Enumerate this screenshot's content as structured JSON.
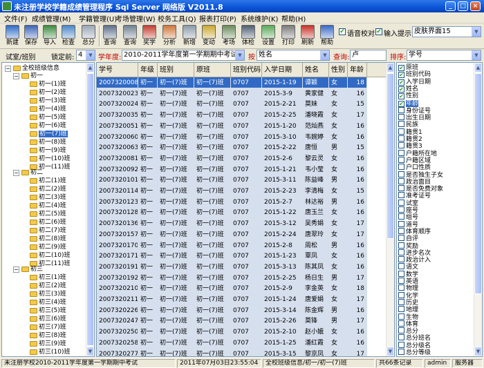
{
  "window": {
    "title": "未注册学校学籍成绩管理程序 Sql Server 网络版 V2011.8",
    "min_label": "_",
    "max_label": "□",
    "close_label": "×"
  },
  "menu": [
    "文件(F)",
    "成绩管理(M)",
    "学籍管理(U)",
    "考场管理(W)",
    "校务工具(Q)",
    "报表打印(P)",
    "系统维护(K)",
    "帮助(H)"
  ],
  "toolbar": {
    "buttons": [
      {
        "label": "新建",
        "icon": "new-icon",
        "color": "#2E6BC7"
      },
      {
        "label": "保存",
        "icon": "save-icon",
        "color": "#3A63B8"
      },
      {
        "label": "导入",
        "icon": "import-icon",
        "color": "#3D8A3D"
      },
      {
        "label": "检查",
        "icon": "check-icon",
        "color": "#4A86C8"
      },
      {
        "label": "总分",
        "icon": "total-icon",
        "color": "#9AA6B6"
      },
      {
        "label": "查询",
        "icon": "query-icon",
        "color": "#5C6E88"
      },
      {
        "label": "查询",
        "icon": "query2-icon",
        "color": "#708090"
      },
      {
        "label": "奖学",
        "icon": "award-icon",
        "color": "#C43C2E"
      },
      {
        "label": "分析",
        "icon": "analyze-icon",
        "color": "#D0763A"
      },
      {
        "label": "新增",
        "icon": "add-icon",
        "color": "#8A9AAA"
      },
      {
        "label": "变动",
        "icon": "change-icon",
        "color": "#C8A830"
      },
      {
        "label": "考场",
        "icon": "exam-room-icon",
        "color": "#6A8A5A"
      },
      {
        "label": "体检",
        "icon": "physical-icon",
        "color": "#4E5E70"
      },
      {
        "label": "设置",
        "icon": "settings-icon",
        "color": "#5AAA5A"
      },
      {
        "label": "打印",
        "icon": "print-icon",
        "color": "#7A7A7A"
      },
      {
        "label": "刷新",
        "icon": "refresh-icon",
        "color": "#C8322A"
      },
      {
        "label": "帮助",
        "icon": "help-icon",
        "color": "#3A6AC8"
      }
    ],
    "voice_check_label": "语音校对",
    "input_hint_label": "输入提示",
    "skin_value": "皮肤界面15"
  },
  "filter": {
    "class_label": "试室/班别",
    "lock_label": "锁定前:",
    "lock_value": "4",
    "term_label": "学年度:",
    "term_value": "2010-2011学年度第一学期期中考试",
    "by_label": "按",
    "by_value": "姓名",
    "query_label": "查询:",
    "query_value": "卢",
    "sort_label": "排序:",
    "sort_value": "学号"
  },
  "tree": {
    "root": "全校班级信息",
    "grade1": "初一",
    "grade1_classes": [
      "初一(1)班",
      "初一(2)班",
      "初一(3)班",
      "初一(4)班",
      "初一(5)班",
      "初一(6)班",
      "初一(7)班",
      "初一(8)班",
      "初一(9)班",
      "初一(10)班",
      "初一(11)班"
    ],
    "grade2": "初二",
    "grade2_classes": [
      "初二(1)班",
      "初二(2)班",
      "初二(3)班",
      "初二(4)班",
      "初二(5)班",
      "初二(6)班",
      "初二(7)班",
      "初二(8)班",
      "初二(9)班",
      "初二(10)班",
      "初二(11)班"
    ],
    "grade3": "初三",
    "grade3_classes": [
      "初三(1)班",
      "初三(2)班",
      "初三(3)班",
      "初三(4)班",
      "初三(5)班",
      "初三(6)班",
      "初三(7)班",
      "初三(8)班",
      "初三(9)班",
      "初三(10)班"
    ]
  },
  "grid": {
    "columns": [
      "学号",
      "年级",
      "班别",
      "原班",
      "班别代码",
      "入学日期",
      "姓名",
      "性别",
      "年龄"
    ],
    "rows": [
      [
        "2007320008",
        "初一",
        "初一(7)班",
        "初一(7)班",
        "0707",
        "2015-1-19",
        "谭颖",
        "女",
        "18"
      ],
      [
        "2007320023",
        "初一",
        "初一(7)班",
        "初一(7)班",
        "0707",
        "2015-3-9",
        "黄家健",
        "女",
        "16"
      ],
      [
        "2007320024",
        "初一",
        "初一(7)班",
        "初一(7)班",
        "0707",
        "2015-2-21",
        "莫妹",
        "女",
        "15"
      ],
      [
        "2007320035",
        "初一",
        "初一(7)班",
        "初一(7)班",
        "0707",
        "2015-2-25",
        "潘晓霞",
        "女",
        "17"
      ],
      [
        "2007320051",
        "初一",
        "初一(7)班",
        "初一(7)班",
        "0707",
        "2015-1-20",
        "范灿燕",
        "女",
        "16"
      ],
      [
        "2007320060",
        "初一",
        "初一(7)班",
        "初一(7)班",
        "0707",
        "2015-3-10",
        "韦婉婷",
        "女",
        "16"
      ],
      [
        "2007320063",
        "初一",
        "初一(7)班",
        "初一(7)班",
        "0707",
        "2015-2-22",
        "唐恒",
        "男",
        "15"
      ],
      [
        "2007320081",
        "初一",
        "初一(7)班",
        "初一(7)班",
        "0707",
        "2015-2-6",
        "黎云灵",
        "女",
        "16"
      ],
      [
        "2007320092",
        "初一",
        "初一(7)班",
        "初一(7)班",
        "0707",
        "2015-1-21",
        "韦小莹",
        "女",
        "16"
      ],
      [
        "2007320101",
        "初一",
        "初一(7)班",
        "初一(7)班",
        "0707",
        "2015-3-11",
        "陈益峰",
        "男",
        "16"
      ],
      [
        "2007320114",
        "初一",
        "初一(7)班",
        "初一(7)班",
        "0707",
        "2015-2-23",
        "李清梅",
        "女",
        "15"
      ],
      [
        "2007320123",
        "初一",
        "初一(7)班",
        "初一(7)班",
        "0707",
        "2015-2-7",
        "林达裕",
        "男",
        "16"
      ],
      [
        "2007320128",
        "初一",
        "初一(7)班",
        "初一(7)班",
        "0707",
        "2015-1-22",
        "唐玉兰",
        "女",
        "16"
      ],
      [
        "2007320136",
        "初一",
        "初一(7)班",
        "初一(7)班",
        "0707",
        "2015-3-12",
        "吴秀娟",
        "女",
        "17"
      ],
      [
        "2007320157",
        "初一",
        "初一(7)班",
        "初一(7)班",
        "0707",
        "2015-2-24",
        "唐翠玲",
        "女",
        "17"
      ],
      [
        "2007320170",
        "初一",
        "初一(7)班",
        "初一(7)班",
        "0707",
        "2015-2-8",
        "周松",
        "男",
        "16"
      ],
      [
        "2007320171",
        "初一",
        "初一(7)班",
        "初一(7)班",
        "0707",
        "2015-1-23",
        "覃凤",
        "女",
        "16"
      ],
      [
        "2007320191",
        "初一",
        "初一(7)班",
        "初一(7)班",
        "0707",
        "2015-3-13",
        "陈其凤",
        "女",
        "16"
      ],
      [
        "2007320192",
        "初一",
        "初一(7)班",
        "初一(7)班",
        "0707",
        "2015-2-25",
        "杨日生",
        "男",
        "17"
      ],
      [
        "2007320210",
        "初一",
        "初一(7)班",
        "初一(7)班",
        "0707",
        "2015-2-9",
        "李金英",
        "女",
        "18"
      ],
      [
        "2007320211",
        "初一",
        "初一(7)班",
        "初一(7)班",
        "0707",
        "2015-1-24",
        "唐爱娟",
        "女",
        "17"
      ],
      [
        "2007320226",
        "初一",
        "初一(7)班",
        "初一(7)班",
        "0707",
        "2015-3-14",
        "陈金辉",
        "男",
        "16"
      ],
      [
        "2007320247",
        "初一",
        "初一(7)班",
        "初一(7)班",
        "0707",
        "2015-2-26",
        "莫锋",
        "男",
        "17"
      ],
      [
        "2007320250",
        "初一",
        "初一(7)班",
        "初一(7)班",
        "0707",
        "2015-2-10",
        "赵小娥",
        "女",
        "16"
      ],
      [
        "2007320258",
        "初一",
        "初一(7)班",
        "初一(7)班",
        "0707",
        "2015-1-25",
        "潘红霞",
        "女",
        "16"
      ],
      [
        "2007320277",
        "初一",
        "初一(7)班",
        "初一(7)班",
        "0707",
        "2015-3-15",
        "黎京凤",
        "女",
        "17"
      ]
    ]
  },
  "fields": [
    {
      "label": "原班",
      "checked": true
    },
    {
      "label": "班别代码",
      "checked": true
    },
    {
      "label": "入学日期",
      "checked": true
    },
    {
      "label": "姓名",
      "checked": true
    },
    {
      "label": "性别",
      "checked": true
    },
    {
      "label": "年龄",
      "checked": true
    },
    {
      "label": "身份证号",
      "checked": false
    },
    {
      "label": "出生日期",
      "checked": false
    },
    {
      "label": "民族",
      "checked": false
    },
    {
      "label": "籍贯1",
      "checked": false
    },
    {
      "label": "籍贯2",
      "checked": false
    },
    {
      "label": "籍贯3",
      "checked": false
    },
    {
      "label": "户籍所在地",
      "checked": false
    },
    {
      "label": "户籍区域",
      "checked": false
    },
    {
      "label": "户口性质",
      "checked": false
    },
    {
      "label": "是否独生子女",
      "checked": false
    },
    {
      "label": "政治面目",
      "checked": false
    },
    {
      "label": "是否免费对象",
      "checked": false
    },
    {
      "label": "准考证号",
      "checked": false
    },
    {
      "label": "试室",
      "checked": false
    },
    {
      "label": "座号",
      "checked": false
    },
    {
      "label": "组号",
      "checked": false
    },
    {
      "label": "道号",
      "checked": false
    },
    {
      "label": "体育顺序",
      "checked": false
    },
    {
      "label": "自评",
      "checked": false
    },
    {
      "label": "奖励",
      "checked": false
    },
    {
      "label": "进步名次",
      "checked": false
    },
    {
      "label": "政治计入",
      "checked": false
    },
    {
      "label": "语文",
      "checked": false
    },
    {
      "label": "数学",
      "checked": false
    },
    {
      "label": "英语",
      "checked": false
    },
    {
      "label": "物理",
      "checked": false
    },
    {
      "label": "化学",
      "checked": false
    },
    {
      "label": "历史",
      "checked": false
    },
    {
      "label": "地理",
      "checked": false
    },
    {
      "label": "生物",
      "checked": false
    },
    {
      "label": "体育",
      "checked": false
    },
    {
      "label": "总分",
      "checked": false
    },
    {
      "label": "总分班名",
      "checked": false
    },
    {
      "label": "总分级名",
      "checked": false
    },
    {
      "label": "总分等级",
      "checked": false
    }
  ],
  "status": {
    "school_term": "未注册学校2010-2011学年度第一学期期中考试",
    "datetime": "2011年07月03日23:55:04",
    "path": "全校班级信息/初一/初一(7)班",
    "count": "共66条记录",
    "user": "admin",
    "server": "服务器"
  },
  "colors": {
    "selection": "#316AC5",
    "grid_cell": "#D6DFEE",
    "title_bar": "#0A55D8"
  }
}
